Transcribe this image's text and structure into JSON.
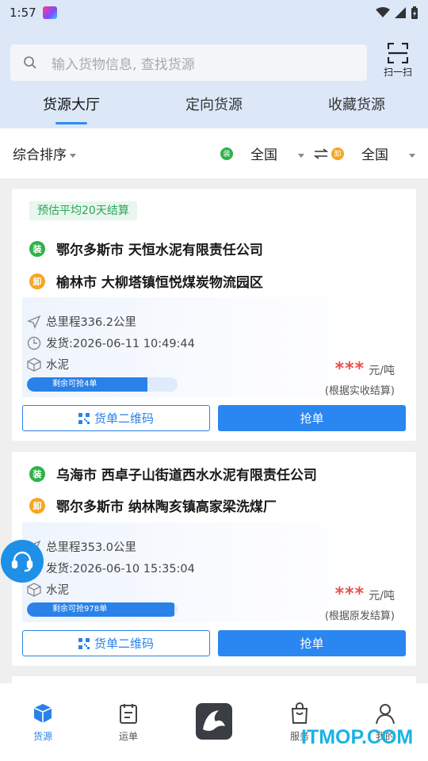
{
  "status_bar": {
    "time": "1:57"
  },
  "search": {
    "placeholder": "输入货物信息, 查找货源"
  },
  "scan": {
    "label": "扫一扫"
  },
  "tabs": [
    {
      "label": "货源大厅",
      "active": true
    },
    {
      "label": "定向货源",
      "active": false
    },
    {
      "label": "收藏货源",
      "active": false
    }
  ],
  "filter": {
    "sort_label": "综合排序",
    "load_icon_text": "装",
    "load_region": "全国",
    "unload_icon_text": "卸",
    "unload_region": "全国"
  },
  "cards": [
    {
      "badge": "预估平均20天结算",
      "load_icon": "装",
      "load_address": "鄂尔多斯市 天恒水泥有限责任公司",
      "unload_icon": "卸",
      "unload_address": "榆林市 大柳塔镇恒悦煤炭物流园区",
      "distance": "总里程336.2公里",
      "ship_time": "发货:2026-06-11 10:49:44",
      "cargo": "水泥",
      "remaining": "剩余可抢4单",
      "remaining_fraction": 0.8,
      "price_masked": "***",
      "price_unit": "元/吨",
      "settlement_note": "(根据实收结算)",
      "qr_button": "货单二维码",
      "grab_button": "抢单"
    },
    {
      "badge": "",
      "load_icon": "装",
      "load_address": "乌海市 西卓子山街道西水水泥有限责任公司",
      "unload_icon": "卸",
      "unload_address": "鄂尔多斯市 纳林陶亥镇高家梁洗煤厂",
      "distance": "总里程353.0公里",
      "ship_time": "发货:2026-06-10 15:35:04",
      "cargo": "水泥",
      "remaining": "剩余可抢978单",
      "remaining_fraction": 0.98,
      "price_masked": "***",
      "price_unit": "元/吨",
      "settlement_note": "(根据原发结算)",
      "qr_button": "货单二维码",
      "grab_button": "抢单"
    }
  ],
  "bottom_nav": [
    {
      "label": "货源",
      "icon": "cube-icon",
      "active": true
    },
    {
      "label": "运单",
      "icon": "clipboard-icon",
      "active": false
    },
    {
      "label": "",
      "icon": "logo-icon",
      "active": false
    },
    {
      "label": "服务",
      "icon": "bag-icon",
      "active": false
    },
    {
      "label": "我的",
      "icon": "user-icon",
      "active": false
    }
  ],
  "watermark": "ITMOP.COM",
  "colors": {
    "accent": "#2a86f0",
    "price": "#e8514a",
    "load": "#2fb24a",
    "unload": "#f5a623"
  }
}
